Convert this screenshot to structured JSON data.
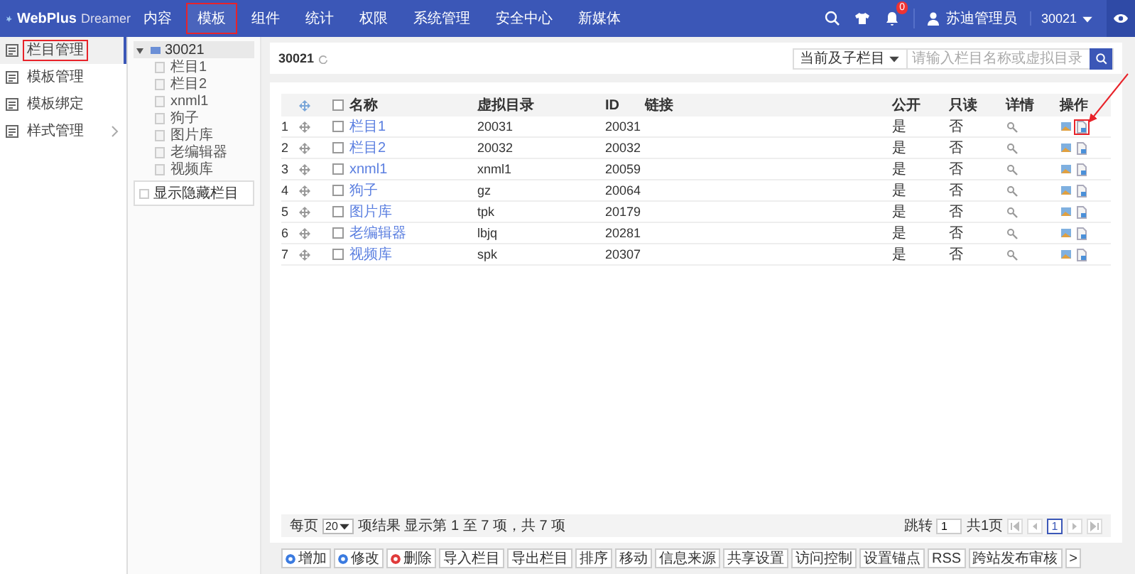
{
  "header": {
    "logo": {
      "brand": "WebPlus",
      "product": "Dreamer"
    },
    "nav": [
      {
        "label": "内容",
        "selected": false,
        "highlighted": false
      },
      {
        "label": "模板",
        "selected": true,
        "highlighted": true
      },
      {
        "label": "组件",
        "selected": false,
        "highlighted": false
      },
      {
        "label": "统计",
        "selected": false,
        "highlighted": false
      },
      {
        "label": "权限",
        "selected": false,
        "highlighted": false
      },
      {
        "label": "系统管理",
        "selected": false,
        "highlighted": false
      },
      {
        "label": "安全中心",
        "selected": false,
        "highlighted": false
      },
      {
        "label": "新媒体",
        "selected": false,
        "highlighted": false
      }
    ],
    "badge": "0",
    "user": "苏迪管理员",
    "site": "30021"
  },
  "sidebar": {
    "items": [
      {
        "label": "栏目管理",
        "selected": true,
        "highlighted": true,
        "has_submenu": false
      },
      {
        "label": "模板管理",
        "selected": false,
        "highlighted": false,
        "has_submenu": false
      },
      {
        "label": "模板绑定",
        "selected": false,
        "highlighted": false,
        "has_submenu": false
      },
      {
        "label": "样式管理",
        "selected": false,
        "highlighted": false,
        "has_submenu": true
      }
    ]
  },
  "tree": {
    "root": {
      "label": "30021",
      "expanded": true,
      "selected": true,
      "children": [
        {
          "label": "栏目1"
        },
        {
          "label": "栏目2"
        },
        {
          "label": "xnml1"
        },
        {
          "label": "狗子"
        },
        {
          "label": "图片库"
        },
        {
          "label": "老编辑器"
        },
        {
          "label": "视频库"
        }
      ]
    },
    "show_hidden": {
      "label": "显示隐藏栏目",
      "checked": false
    }
  },
  "toolbar": {
    "title": "30021",
    "scope": "当前及子栏目",
    "search_placeholder": "请输入栏目名称或虚拟目录"
  },
  "table": {
    "select_all_checked": false,
    "columns": [
      "名称",
      "虚拟目录",
      "ID",
      "链接",
      "公开",
      "只读",
      "详情",
      "操作"
    ],
    "rows": [
      {
        "index": "1",
        "name": "栏目1",
        "directory": "20031",
        "id": "20031",
        "public": "是",
        "readonly": "否",
        "checked": false,
        "highlighted": true
      },
      {
        "index": "2",
        "name": "栏目2",
        "directory": "20032",
        "id": "20032",
        "public": "是",
        "readonly": "否",
        "checked": false,
        "highlighted": false
      },
      {
        "index": "3",
        "name": "xnml1",
        "directory": "xnml1",
        "id": "20059",
        "public": "是",
        "readonly": "否",
        "checked": false,
        "highlighted": false
      },
      {
        "index": "4",
        "name": "狗子",
        "directory": "gz",
        "id": "20064",
        "public": "是",
        "readonly": "否",
        "checked": false,
        "highlighted": false
      },
      {
        "index": "5",
        "name": "图片库",
        "directory": "tpk",
        "id": "20179",
        "public": "是",
        "readonly": "否",
        "checked": false,
        "highlighted": false
      },
      {
        "index": "6",
        "name": "老编辑器",
        "directory": "lbjq",
        "id": "20281",
        "public": "是",
        "readonly": "否",
        "checked": false,
        "highlighted": false
      },
      {
        "index": "7",
        "name": "视频库",
        "directory": "spk",
        "id": "20307",
        "public": "是",
        "readonly": "否",
        "checked": false,
        "highlighted": false
      }
    ]
  },
  "pagination": {
    "per_page_label": "每页",
    "per_page": "20",
    "summary": "项结果 显示第 1 至 7 项，共 7 项",
    "jump_label": "跳转",
    "jump_value": "1",
    "total_pages": "共1页",
    "current_page": "1"
  },
  "actions": [
    {
      "label": "增加",
      "kind": "add"
    },
    {
      "label": "修改",
      "kind": "edit"
    },
    {
      "label": "删除",
      "kind": "delete"
    },
    {
      "label": "导入栏目",
      "kind": "plain"
    },
    {
      "label": "导出栏目",
      "kind": "plain"
    },
    {
      "label": "排序",
      "kind": "plain"
    },
    {
      "label": "移动",
      "kind": "plain"
    },
    {
      "label": "信息来源",
      "kind": "plain"
    },
    {
      "label": "共享设置",
      "kind": "plain"
    },
    {
      "label": "访问控制",
      "kind": "plain"
    },
    {
      "label": "设置锚点",
      "kind": "plain"
    },
    {
      "label": "RSS",
      "kind": "plain"
    },
    {
      "label": "跨站发布审核",
      "kind": "plain"
    },
    {
      "label": ">",
      "kind": "plain"
    }
  ],
  "annotation_arrow": true
}
